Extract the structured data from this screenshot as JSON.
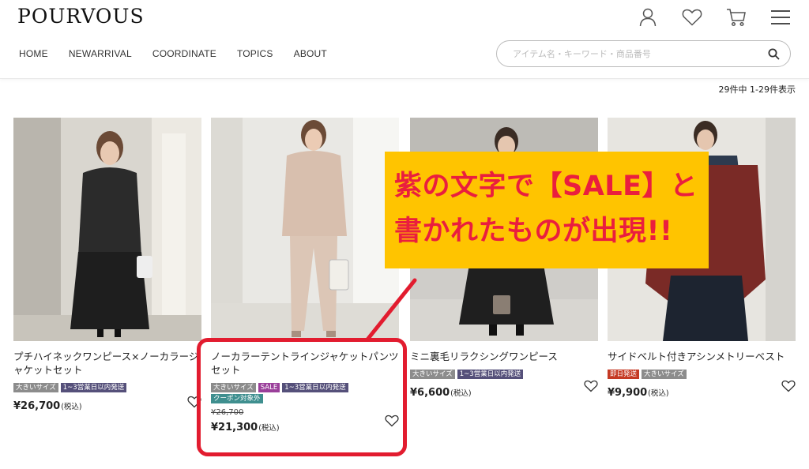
{
  "header": {
    "logo": "POURVOUS",
    "icons": [
      "user-icon",
      "heart-icon",
      "cart-icon",
      "menu-icon"
    ],
    "nav": [
      "HOME",
      "NEWARRIVAL",
      "COORDINATE",
      "TOPICS",
      "ABOUT"
    ],
    "search_placeholder": "アイテム名・キーワード・商品番号"
  },
  "results_count": "29件中 1-29件表示",
  "products": [
    {
      "name": "プチハイネックワンピース×ノーカラージャケットセット",
      "badges": [
        {
          "label": "大きいサイズ",
          "color": "#8c8c8c"
        },
        {
          "label": "1~3営業日以内発送",
          "color": "#55507a"
        }
      ],
      "price": "¥26,700",
      "tax": "(税込)"
    },
    {
      "name": "ノーカラーテントラインジャケットパンツセット",
      "badges": [
        {
          "label": "大きいサイズ",
          "color": "#8c8c8c"
        },
        {
          "label": "SALE",
          "color": "#9a3f9a"
        },
        {
          "label": "1~3営業日以内発送",
          "color": "#55507a"
        },
        {
          "label": "クーポン対象外",
          "color": "#3f8f8f"
        }
      ],
      "old_price": "¥26,700",
      "price": "¥21,300",
      "tax": "(税込)"
    },
    {
      "name": "ミニ裏毛リラクシングワンピース",
      "badges": [
        {
          "label": "大きいサイズ",
          "color": "#8c8c8c"
        },
        {
          "label": "1~3営業日以内発送",
          "color": "#55507a"
        }
      ],
      "price": "¥6,600",
      "tax": "(税込)"
    },
    {
      "name": "サイドベルト付きアシンメトリーベスト",
      "badges": [
        {
          "label": "即日発送",
          "color": "#c53a24"
        },
        {
          "label": "大きいサイズ",
          "color": "#8c8c8c"
        }
      ],
      "price": "¥9,900",
      "tax": "(税込)"
    }
  ],
  "callout": {
    "line1": "紫の文字で【SALE】と",
    "line2": "書かれたものが出現!!",
    "background": "#ffc400",
    "text_color": "#ea1e3e"
  },
  "highlight_color": "#e21c2f"
}
